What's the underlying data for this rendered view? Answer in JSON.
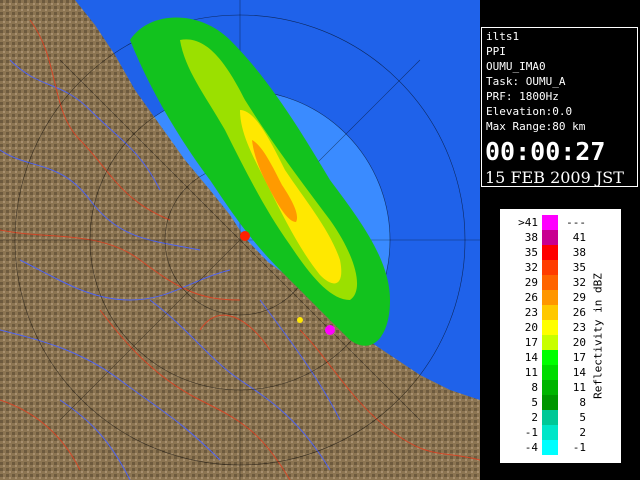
{
  "info_panel": {
    "lines": [
      "ilts1",
      "PPI",
      "OUMU_IMA0",
      "Task: OUMU_A",
      "PRF: 1800Hz",
      "Elevation:0.0",
      "Max Range:80 km"
    ],
    "time": "00:00:27",
    "date": "15 FEB 2009 JST"
  },
  "legend": {
    "unit_label": "Reflectivity in dBZ",
    "rows": [
      {
        "lo": ">41",
        "hi": "---",
        "color": "#ff00ff"
      },
      {
        "lo": "38",
        "hi": "41",
        "color": "#c80090"
      },
      {
        "lo": "35",
        "hi": "38",
        "color": "#ff0000"
      },
      {
        "lo": "32",
        "hi": "35",
        "color": "#ff3c00"
      },
      {
        "lo": "29",
        "hi": "32",
        "color": "#ff6400"
      },
      {
        "lo": "26",
        "hi": "29",
        "color": "#ff9600"
      },
      {
        "lo": "23",
        "hi": "26",
        "color": "#ffc800"
      },
      {
        "lo": "20",
        "hi": "23",
        "color": "#ffff00"
      },
      {
        "lo": "17",
        "hi": "20",
        "color": "#c8ff00"
      },
      {
        "lo": "14",
        "hi": "17",
        "color": "#00ff00"
      },
      {
        "lo": "11",
        "hi": "14",
        "color": "#00dc00"
      },
      {
        "lo": "8",
        "hi": "11",
        "color": "#00b400"
      },
      {
        "lo": "5",
        "hi": "8",
        "color": "#009600"
      },
      {
        "lo": "2",
        "hi": "5",
        "color": "#00c896"
      },
      {
        "lo": "-1",
        "hi": "2",
        "color": "#00e6c8"
      },
      {
        "lo": "-4",
        "hi": "-1",
        "color": "#00ffff"
      }
    ]
  },
  "colors": {
    "land": "#8a7350",
    "sea_outer": "#1f62ea",
    "radar_disc": "#3a8bff",
    "echo_green": "#12c21e",
    "echo_yellow": "#ffe800",
    "echo_orange": "#ff9a00",
    "rivers": "#4a63ff",
    "borders": "#e04020"
  }
}
